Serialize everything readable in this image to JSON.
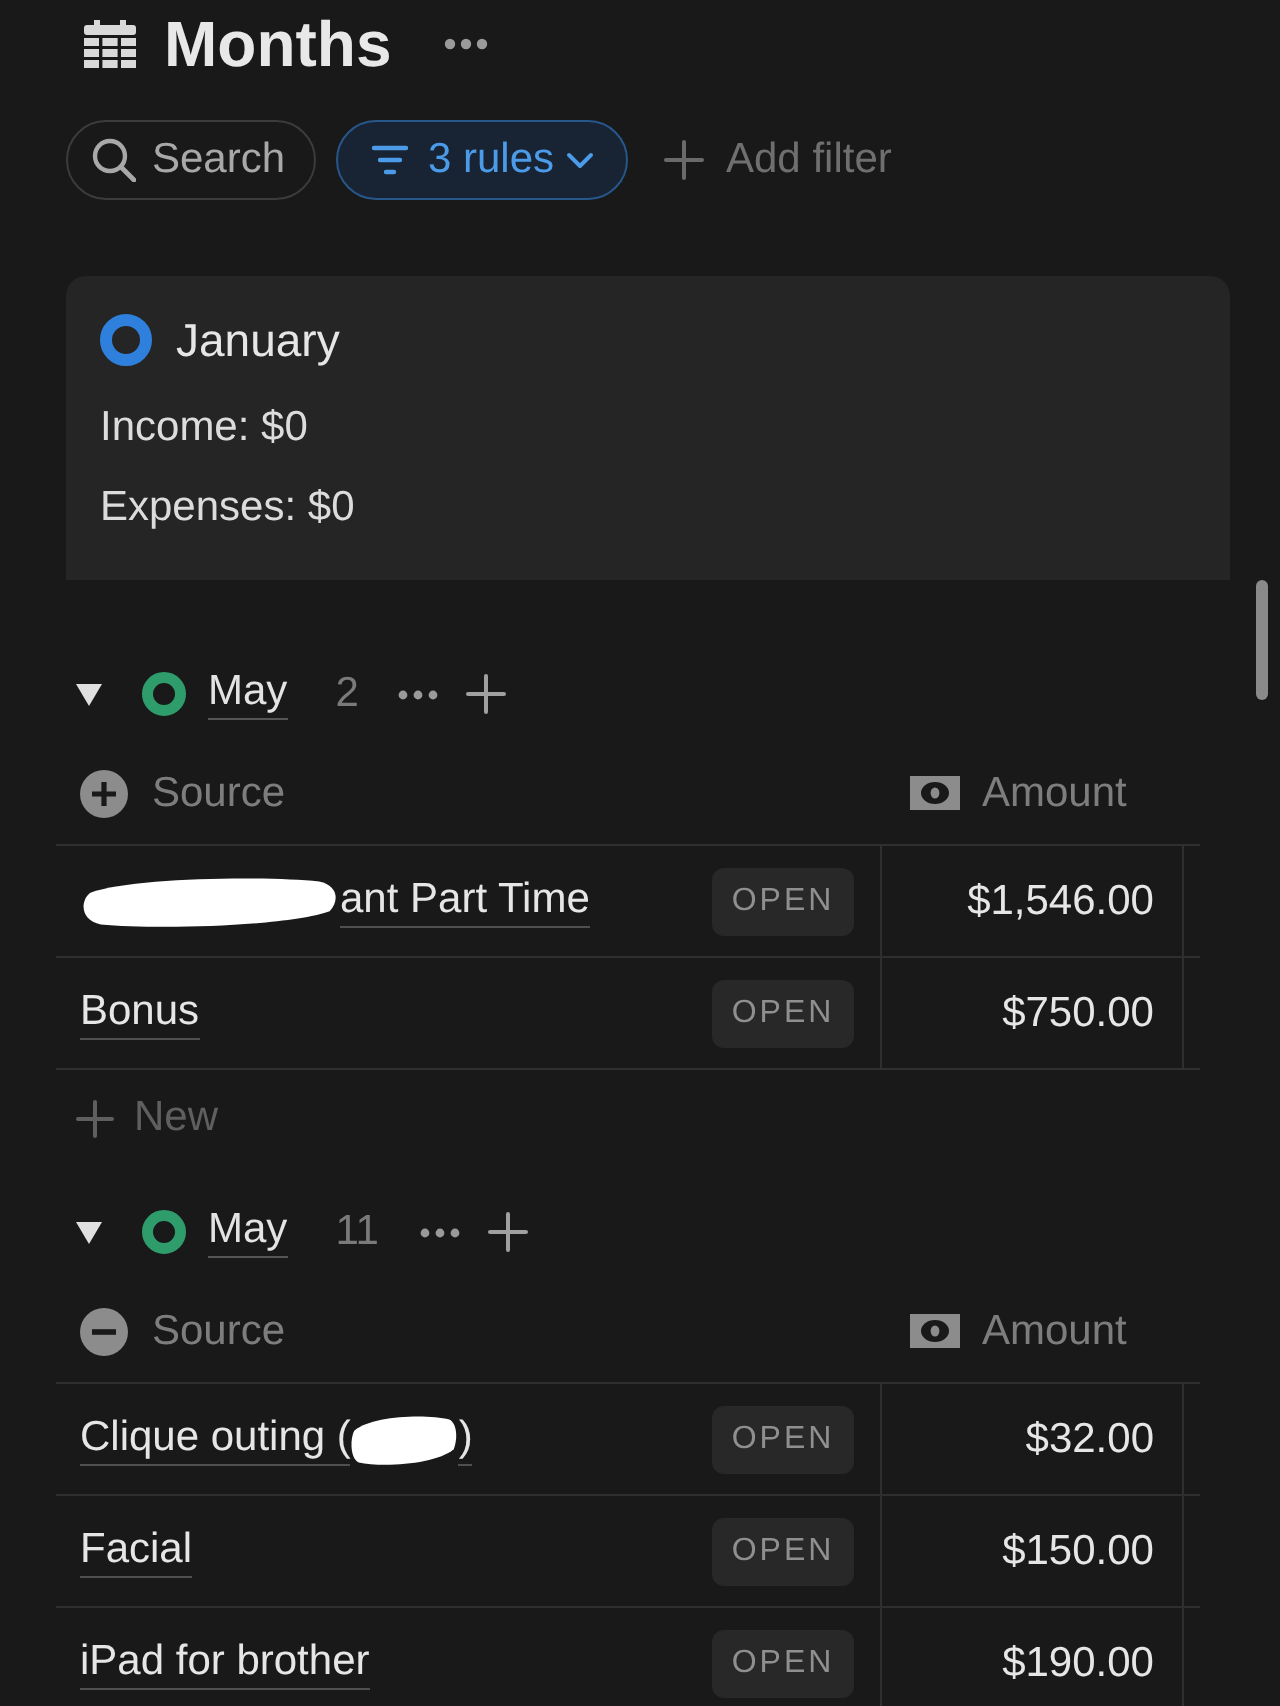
{
  "header": {
    "title": "Months"
  },
  "filters": {
    "search": {
      "label": "Search"
    },
    "rules": {
      "label": "3 rules",
      "active": true
    },
    "add_filter": {
      "label": "Add filter"
    }
  },
  "card": {
    "title": "January",
    "lines": [
      "Income: $0",
      "Expenses: $0"
    ]
  },
  "groups": [
    {
      "name": "May",
      "count": "2",
      "kind": "income",
      "expanded": true,
      "columns": [
        {
          "kind": "title",
          "label": "Source"
        },
        {
          "kind": "number",
          "label": "Amount"
        }
      ],
      "rows": [
        {
          "title_parts": [
            {
              "kind": "redaction"
            },
            {
              "kind": "text",
              "text": "ant Part Time"
            }
          ],
          "open_label": "OPEN",
          "amount": "$1,546.00"
        },
        {
          "title_parts": [
            {
              "kind": "text",
              "text": "Bonus"
            }
          ],
          "open_label": "OPEN",
          "amount": "$750.00"
        }
      ],
      "new_label": "New"
    },
    {
      "name": "May",
      "count": "11",
      "kind": "expense",
      "expanded": true,
      "columns": [
        {
          "kind": "title",
          "label": "Source"
        },
        {
          "kind": "number",
          "label": "Amount"
        }
      ],
      "rows": [
        {
          "title_parts": [
            {
              "kind": "text",
              "text": "Clique outing ("
            },
            {
              "kind": "redaction"
            },
            {
              "kind": "text",
              "text": ")"
            }
          ],
          "open_label": "OPEN",
          "amount": "$32.00"
        },
        {
          "title_parts": [
            {
              "kind": "text",
              "text": "Facial"
            }
          ],
          "open_label": "OPEN",
          "amount": "$150.00"
        },
        {
          "title_parts": [
            {
              "kind": "text",
              "text": "iPad for brother"
            }
          ],
          "open_label": "OPEN",
          "amount": "$190.00"
        }
      ]
    }
  ]
}
